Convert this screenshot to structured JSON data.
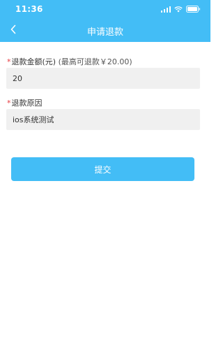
{
  "status_bar": {
    "time": "11:36",
    "icons": [
      "signal-icon",
      "wifi-icon",
      "battery-icon"
    ]
  },
  "nav": {
    "back_icon": "chevron-left-icon",
    "title": "申请退款"
  },
  "form": {
    "amount": {
      "required_mark": "*",
      "label": "退款金额(元)",
      "hint": "(最高可退款￥20.00)",
      "value": "20"
    },
    "reason": {
      "required_mark": "*",
      "label": "退款原因",
      "value": "ios系统测试"
    }
  },
  "submit_label": "提交",
  "colors": {
    "accent": "#43bdf6",
    "required": "#e6393f",
    "input_bg": "#f0f0f0",
    "text": "#333333"
  }
}
